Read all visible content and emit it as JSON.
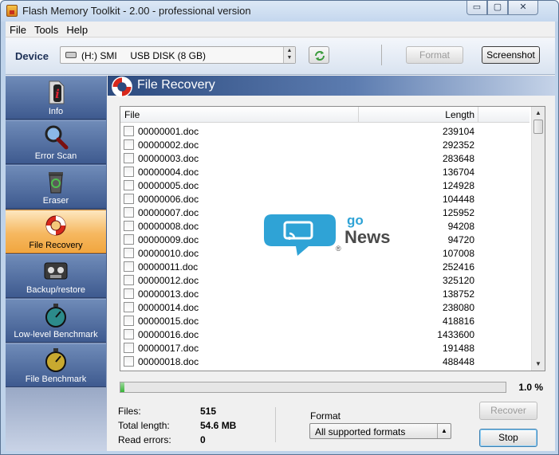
{
  "window": {
    "title": "Flash Memory Toolkit - 2.00 - professional version",
    "controls": {
      "minimize": "▭",
      "maximize": "▢",
      "close": "✕"
    }
  },
  "menu": [
    "File",
    "Tools",
    "Help"
  ],
  "device": {
    "label": "Device",
    "selected": "(H:) SMI     USB DISK (8 GB)",
    "format_button": "Format",
    "screenshot_button": "Screenshot"
  },
  "sidebar": {
    "items": [
      {
        "label": "Info",
        "icon": "info-icon",
        "active": false
      },
      {
        "label": "Error Scan",
        "icon": "magnifier-icon",
        "active": false
      },
      {
        "label": "Eraser",
        "icon": "recycle-bin-icon",
        "active": false
      },
      {
        "label": "File Recovery",
        "icon": "lifebuoy-icon",
        "active": true
      },
      {
        "label": "Backup/restore",
        "icon": "tape-icon",
        "active": false
      },
      {
        "label": "Low-level Benchmark",
        "icon": "stopwatch-icon",
        "active": false
      },
      {
        "label": "File Benchmark",
        "icon": "stopwatch-icon",
        "active": false
      }
    ]
  },
  "panel": {
    "title": "File Recovery",
    "columns": {
      "file": "File",
      "length": "Length"
    },
    "files": [
      {
        "name": "00000001.doc",
        "length": "239104"
      },
      {
        "name": "00000002.doc",
        "length": "292352"
      },
      {
        "name": "00000003.doc",
        "length": "283648"
      },
      {
        "name": "00000004.doc",
        "length": "136704"
      },
      {
        "name": "00000005.doc",
        "length": "124928"
      },
      {
        "name": "00000006.doc",
        "length": "104448"
      },
      {
        "name": "00000007.doc",
        "length": "125952"
      },
      {
        "name": "00000008.doc",
        "length": "94208"
      },
      {
        "name": "00000009.doc",
        "length": "94720"
      },
      {
        "name": "00000010.doc",
        "length": "107008"
      },
      {
        "name": "00000011.doc",
        "length": "252416"
      },
      {
        "name": "00000012.doc",
        "length": "325120"
      },
      {
        "name": "00000013.doc",
        "length": "138752"
      },
      {
        "name": "00000014.doc",
        "length": "238080"
      },
      {
        "name": "00000015.doc",
        "length": "418816"
      },
      {
        "name": "00000016.doc",
        "length": "1433600"
      },
      {
        "name": "00000017.doc",
        "length": "191488"
      },
      {
        "name": "00000018.doc",
        "length": "488448"
      }
    ],
    "progress": {
      "percent": 1.0,
      "text": "1.0 %"
    },
    "stats": {
      "files_label": "Files:",
      "files_value": "515",
      "total_label": "Total length:",
      "total_value": "54.6 MB",
      "errors_label": "Read errors:",
      "errors_value": "0"
    },
    "format_label": "Format",
    "format_value": "All supported formats",
    "recover_button": "Recover",
    "stop_button": "Stop"
  },
  "watermark": {
    "top": "go",
    "bottom": "News",
    "mark": "®"
  },
  "colors": {
    "sidebar_active": "#f6b860",
    "header_blue": "#2c4a7e",
    "progress_green": "#37b437",
    "watermark_blue": "#2fa3d6"
  }
}
